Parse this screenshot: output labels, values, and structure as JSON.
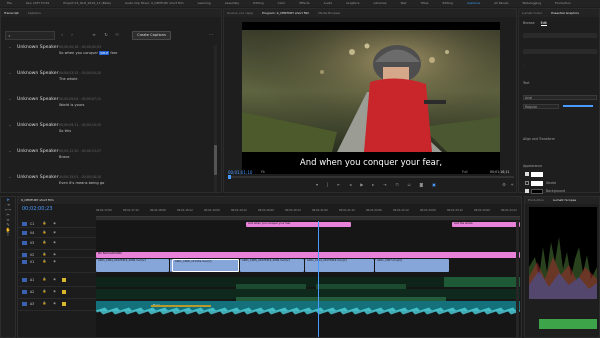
{
  "menu": [
    "File",
    "Kev. LT/FI T0 E2",
    "Project 03_OLH_2019_11 (Beta)",
    "Audio Clip Mixer: 9_CENTURY short film",
    "Learning",
    "Assembly",
    "Editing",
    "Color",
    "Effects",
    "Audio",
    "Graphics",
    "Libraries",
    "Text",
    "Titles",
    "Editing",
    "Captions",
    "All Panels",
    "Metalogging",
    "Production"
  ],
  "menu_active_index": 15,
  "left_panel": {
    "tabs": [
      "Transcript",
      "Captions"
    ],
    "create_captions_label": "Create Captions",
    "entries": [
      {
        "speaker": "Unknown Speaker",
        "time": "00;00;00;18 - 00;00;02;03",
        "text_before": "So when you conquer",
        "text_highlight": "your",
        "text_after": "fear"
      },
      {
        "speaker": "Unknown Speaker",
        "time": "00;00;03;15 - 00;00;04;20",
        "text_before": "The whole",
        "text_highlight": "",
        "text_after": ""
      },
      {
        "speaker": "Unknown Speaker",
        "time": "00;00;05;04 - 00;00;07;12",
        "text_before": "World is yours",
        "text_highlight": "",
        "text_after": ""
      },
      {
        "speaker": "Unknown Speaker",
        "time": "00;00;09;11 - 00;00;10;15",
        "text_before": "So this",
        "text_highlight": "",
        "text_after": ""
      },
      {
        "speaker": "Unknown Speaker",
        "time": "00;00;12;20 - 00;00;13;27",
        "text_before": "Brave",
        "text_highlight": "",
        "text_after": ""
      },
      {
        "speaker": "Unknown Speaker",
        "time": "00;00;15;01 - 00;00;18;10",
        "text_before": "Even it's means being go",
        "text_highlight": "",
        "text_after": ""
      }
    ]
  },
  "program": {
    "tabs": [
      "Source: (no clips)",
      "Program: 9_CENTURY short film",
      "Media Browser"
    ],
    "caption": "And when you conquer your fear,",
    "timecode_left": "00;01;01;10",
    "fit": "Fit",
    "quality": "Full",
    "timecode_right": "00;01;16;11"
  },
  "right_panel": {
    "tabs": [
      "Lumetri Color",
      "Essential Graphics"
    ],
    "sub_tabs": [
      "Browse",
      "Edit"
    ],
    "section_caption": "Text",
    "font": "Arial",
    "style": "Regular",
    "align_label": "Align and Transform",
    "appearance_label": "Appearance",
    "fill_label": "Fill",
    "stroke_label": "Stroke",
    "background_label": "Background"
  },
  "timeline": {
    "tab": "9_CENTURY short film",
    "timecode": "00;02;00;23",
    "ruler": [
      "00;01;17;00",
      "00;01;17;12",
      "00;01;18;00",
      "00;01;18;12",
      "00;01;19;00",
      "00;01;19;12",
      "00;01;20;00",
      "00;01;20;12",
      "00;01;21;00",
      "00;01;21;12",
      "00;01;22;00",
      "00;01;22;12",
      "00;01;23;00",
      "00;01;23;12",
      "00;01;24;00",
      "00;01;24;12"
    ],
    "tracks": [
      "C1",
      "V4",
      "V3",
      "V2",
      "V1",
      "A1",
      "A2",
      "A3"
    ],
    "caption_clips": [
      "And when you conquer your fear",
      "And the whole"
    ],
    "v3_label": "MC BACKGROUND",
    "v1_clips": [
      "A001_C004_20170919_2000.mov[V]",
      "A001_C004_20170919_2000.mov[V]",
      "A001_C008_1213AS.mov[V]",
      "A001_C005_20170919_2000.mov[V]",
      "A001_C014_20170919.mov[V]",
      "A001_C007.mov[V]"
    ],
    "a3_label": "Music"
  },
  "scopes": {
    "tab_left": "Production",
    "tab_right": "Lumetri Scopes"
  },
  "colors": {
    "accent": "#3b9bff",
    "caption_clip": "#e782d8",
    "video_clip": "#86a5d8",
    "audio_clip": "#1c4b2f",
    "music_clip": "#1b9ea5",
    "track_label": "#3a62b0"
  }
}
